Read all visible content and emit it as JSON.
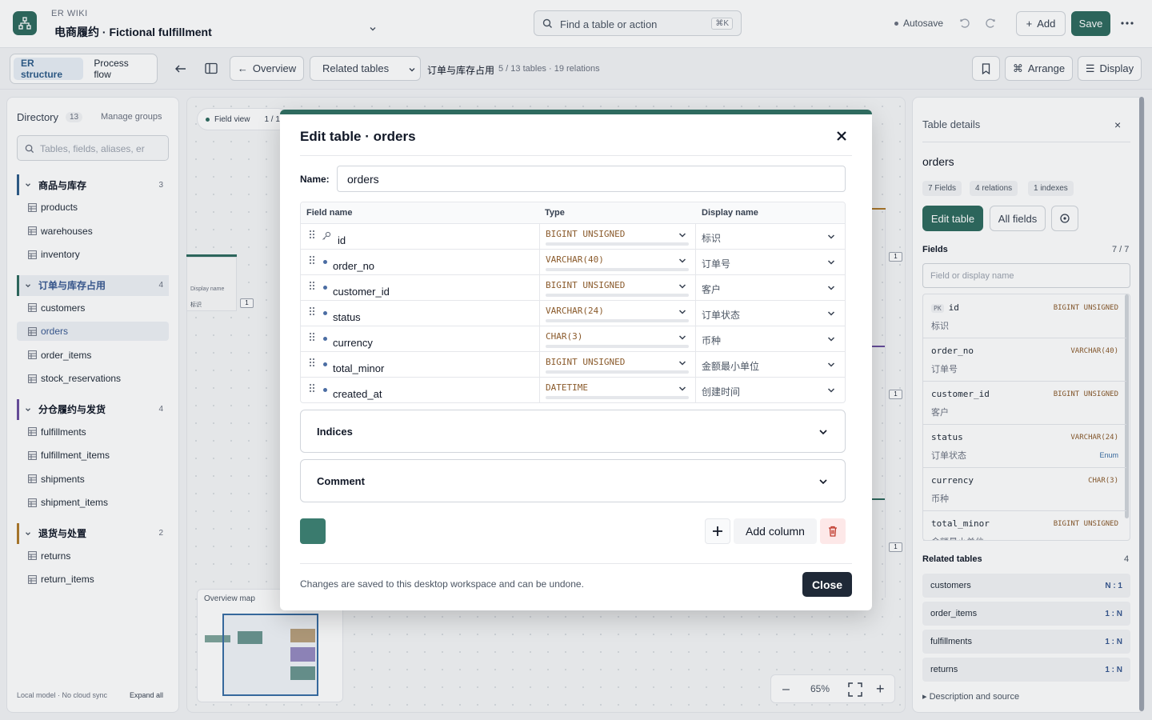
{
  "header": {
    "app_name": "ER WIKI",
    "project": "电商履约 · Fictional fulfillment",
    "search_placeholder": "Find a table or action",
    "search_shortcut": "⌘K",
    "autosave": "Autosave",
    "add_label": "Add",
    "save_label": "Save"
  },
  "toolbar": {
    "tabs": [
      "ER structure",
      "Process flow"
    ],
    "overview_label": "Overview",
    "related_select": "Related tables",
    "breadcrumb": "订单与库存占用",
    "breadcrumb_meta": "5 / 13 tables · 19 relations",
    "arrange_label": "Arrange",
    "display_label": "Display"
  },
  "directory": {
    "title": "Directory",
    "count": "13",
    "manage": "Manage groups",
    "search_placeholder": "Tables, fields, aliases, er",
    "groups": [
      {
        "name": "商品与库存",
        "count": "3",
        "color": "#2f5d8a",
        "tables": [
          "products",
          "warehouses",
          "inventory"
        ]
      },
      {
        "name": "订单与库存占用",
        "count": "4",
        "color": "#2f6b5f",
        "tables": [
          "customers",
          "orders",
          "order_items",
          "stock_reservations"
        ]
      },
      {
        "name": "分仓履约与发货",
        "count": "4",
        "color": "#6b4fa0",
        "tables": [
          "fulfillments",
          "fulfillment_items",
          "shipments",
          "shipment_items"
        ]
      },
      {
        "name": "退货与处置",
        "count": "2",
        "color": "#b07a2a",
        "tables": [
          "returns",
          "return_items"
        ]
      }
    ],
    "footer_left": "Local model · No cloud sync",
    "footer_right": "Expand all"
  },
  "canvas": {
    "field_view": "Field view",
    "field_view_page": "1 / 1",
    "snippet_label": "Display name",
    "snippet_value": "标识",
    "overview_map": "Overview map",
    "zoom_level": "65%"
  },
  "details": {
    "title": "Table details",
    "table_name": "orders",
    "chips": [
      "7 Fields",
      "4 relations",
      "1 indexes"
    ],
    "edit_label": "Edit table",
    "all_fields_label": "All fields",
    "fields_title": "Fields",
    "fields_count": "7 / 7",
    "fields_placeholder": "Field or display name",
    "fields": [
      {
        "pk": "PK",
        "name": "id",
        "type": "BIGINT UNSIGNED",
        "display": "标识"
      },
      {
        "name": "order_no",
        "type": "VARCHAR(40)",
        "display": "订单号"
      },
      {
        "name": "customer_id",
        "type": "BIGINT UNSIGNED",
        "display": "客户"
      },
      {
        "name": "status",
        "type": "VARCHAR(24)",
        "display": "订单状态",
        "tag": "Enum"
      },
      {
        "name": "currency",
        "type": "CHAR(3)",
        "display": "币种"
      },
      {
        "name": "total_minor",
        "type": "BIGINT UNSIGNED",
        "display": "金额最小单位"
      }
    ],
    "related_title": "Related tables",
    "related_count": "4",
    "related": [
      {
        "name": "customers",
        "card": "N : 1"
      },
      {
        "name": "order_items",
        "card": "1 : N"
      },
      {
        "name": "fulfillments",
        "card": "1 : N"
      },
      {
        "name": "returns",
        "card": "1 : N"
      }
    ],
    "description_label": "Description and source"
  },
  "modal": {
    "title": "Edit table · orders",
    "name_label": "Name:",
    "name_value": "orders",
    "columns": [
      "Field name",
      "Type",
      "Display name"
    ],
    "rows": [
      {
        "name": "id",
        "type": "BIGINT UNSIGNED",
        "display": "标识",
        "key": true
      },
      {
        "name": "order_no",
        "type": "VARCHAR(40)",
        "display": "订单号"
      },
      {
        "name": "customer_id",
        "type": "BIGINT UNSIGNED",
        "display": "客户"
      },
      {
        "name": "status",
        "type": "VARCHAR(24)",
        "display": "订单状态"
      },
      {
        "name": "currency",
        "type": "CHAR(3)",
        "display": "币种"
      },
      {
        "name": "total_minor",
        "type": "BIGINT UNSIGNED",
        "display": "金额最小单位"
      },
      {
        "name": "created_at",
        "type": "DATETIME",
        "display": "创建时间"
      }
    ],
    "indices_label": "Indices",
    "comment_label": "Comment",
    "table_color": "#3a7b6e",
    "add_column_label": "Add column",
    "footnote": "Changes are saved to this desktop workspace and can be undone.",
    "close_label": "Close"
  }
}
